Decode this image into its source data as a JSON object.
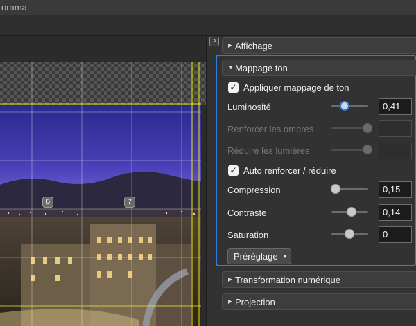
{
  "window": {
    "title": "orama"
  },
  "preview": {
    "node_labels": [
      "6",
      "7"
    ]
  },
  "panel": {
    "collapse_icon": ">",
    "sections": {
      "affichage": "Affichage",
      "mappage": "Mappage ton",
      "transformation": "Transformation numérique",
      "projection": "Projection"
    },
    "tone": {
      "apply_label": "Appliquer mappage de ton",
      "apply_checked": true,
      "luminosite": {
        "label": "Luminosité",
        "value": "0,41",
        "level": 0.41
      },
      "ombres": {
        "label": "Renforcer les ombres",
        "value": "",
        "level": 1.0,
        "enabled": false
      },
      "lumieres": {
        "label": "Réduire les lumières",
        "value": "",
        "level": 1.0,
        "enabled": false
      },
      "auto_label": "Auto renforcer / réduire",
      "auto_checked": true,
      "compression": {
        "label": "Compression",
        "value": "0,15",
        "level": 0.15
      },
      "contraste": {
        "label": "Contraste",
        "value": "0,14",
        "level": 0.57
      },
      "saturation": {
        "label": "Saturation",
        "value": "0",
        "level": 0.5
      },
      "preset_label": "Préréglage"
    }
  },
  "colors": {
    "accent": "#2b7fe0",
    "guide": "#f0e800"
  }
}
